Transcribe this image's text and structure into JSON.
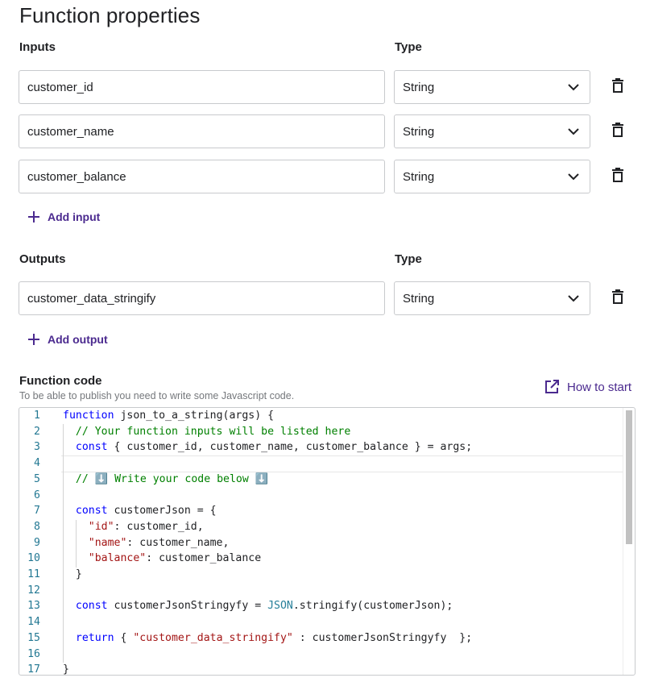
{
  "page_title": "Function properties",
  "inputs_section": {
    "label": "Inputs",
    "type_label": "Type",
    "rows": [
      {
        "name": "customer_id",
        "type": "String"
      },
      {
        "name": "customer_name",
        "type": "String"
      },
      {
        "name": "customer_balance",
        "type": "String"
      }
    ],
    "add_label": "Add input"
  },
  "outputs_section": {
    "label": "Outputs",
    "type_label": "Type",
    "rows": [
      {
        "name": "customer_data_stringify",
        "type": "String"
      }
    ],
    "add_label": "Add output"
  },
  "code_section": {
    "label": "Function code",
    "hint": "To be able to publish you need to write some Javascript code.",
    "how_to_label": "How to start",
    "line_numbers": [
      "1",
      "2",
      "3",
      "4",
      "5",
      "6",
      "7",
      "8",
      "9",
      "10",
      "11",
      "12",
      "13",
      "14",
      "15",
      "16",
      "17"
    ],
    "lines": [
      "function json_to_a_string(args) {",
      "  // Your function inputs will be listed here",
      "  const { customer_id, customer_name, customer_balance } = args;",
      "",
      "  // ⬇️ Write your code below ⬇️",
      "",
      "  const customerJson = {",
      "    \"id\": customer_id,",
      "    \"name\": customer_name,",
      "    \"balance\": customer_balance",
      "  }",
      "",
      "  const customerJsonStringyfy = JSON.stringify(customerJson);",
      "",
      "  return { \"customer_data_stringify\" : customerJsonStringyfy  };",
      "",
      "}"
    ]
  },
  "icons": {
    "chevron": "chevron-down-icon",
    "trash": "trash-icon",
    "plus": "plus-icon",
    "external": "open-in-new-icon"
  },
  "colors": {
    "accent": "#4b2a8f",
    "border": "#c8cacd",
    "keyword": "#0000ff",
    "comment": "#008000",
    "string": "#a31515",
    "line_number": "#237893"
  }
}
